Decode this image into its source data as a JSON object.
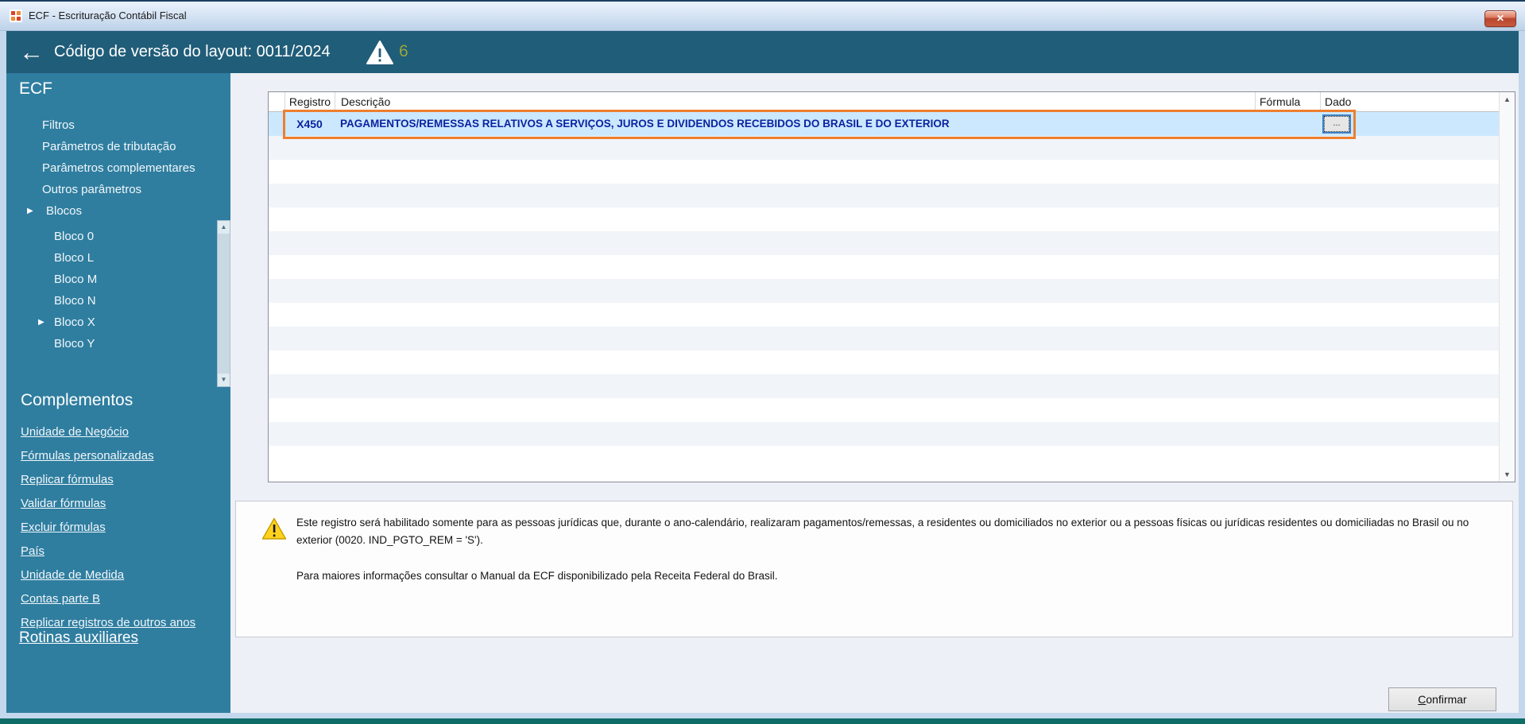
{
  "window": {
    "title": "ECF - Escrituração Contábil Fiscal"
  },
  "header": {
    "title": "Código de versão do layout: 0011/2024",
    "warning_count": "6"
  },
  "sidebar": {
    "title": "ECF",
    "items": [
      {
        "label": "Filtros",
        "indent": 1,
        "arrow": false
      },
      {
        "label": "Parâmetros de tributação",
        "indent": 1,
        "arrow": false
      },
      {
        "label": "Parâmetros complementares",
        "indent": 1,
        "arrow": false
      },
      {
        "label": "Outros parâmetros",
        "indent": 1,
        "arrow": false
      },
      {
        "label": "Blocos",
        "indent": 0,
        "arrow": true
      },
      {
        "label": "Bloco 0",
        "indent": 2,
        "arrow": false
      },
      {
        "label": "Bloco L",
        "indent": 2,
        "arrow": false
      },
      {
        "label": "Bloco M",
        "indent": 2,
        "arrow": false
      },
      {
        "label": "Bloco N",
        "indent": 2,
        "arrow": false
      },
      {
        "label": "Bloco X",
        "indent": 2,
        "arrow": true
      },
      {
        "label": "Bloco Y",
        "indent": 2,
        "arrow": false
      }
    ],
    "complements_title": "Complementos",
    "links": [
      "Unidade de Negócio",
      "Fórmulas personalizadas",
      "Replicar fórmulas",
      "Validar fórmulas",
      "Excluir fórmulas",
      "País",
      "Unidade de Medida",
      "Contas parte B",
      "Replicar registros de outros anos"
    ],
    "footer_link": "Rotinas auxiliares"
  },
  "grid": {
    "columns": [
      "Registro",
      "Descrição",
      "Fórmula",
      "Dado"
    ],
    "rows": [
      {
        "registro": "X450",
        "descricao": "PAGAMENTOS/REMESSAS RELATIVOS A SERVIÇOS, JUROS E DIVIDENDOS RECEBIDOS DO BRASIL E DO EXTERIOR",
        "dado_button": "..."
      }
    ],
    "empty_row_count": 14
  },
  "info_panel": {
    "paragraph1": "Este registro será habilitado somente para as pessoas jurídicas que, durante o ano-calendário, realizaram pagamentos/remessas, a residentes ou domiciliados no exterior ou a pessoas físicas ou jurídicas residentes ou domiciliadas no Brasil ou no exterior (0020. IND_PGTO_REM = 'S').",
    "paragraph2": "Para maiores informações consultar o Manual da ECF disponibilizado pela Receita Federal do Brasil."
  },
  "footer": {
    "confirm_label": "Confirmar"
  },
  "icons": {
    "back": "←",
    "close": "✕",
    "tree_arrow": "▶",
    "scroll_up": "▲",
    "scroll_down": "▼"
  },
  "colors": {
    "header_teal": "#205d78",
    "sidebar_teal": "#2f7ea0",
    "selection_orange": "#ee7f2d",
    "selected_row_blue": "#cce8ff",
    "record_text_navy": "#0b23a0",
    "warning_count_olive": "#98a63c",
    "bottom_accent_teal": "#0e6e67"
  }
}
